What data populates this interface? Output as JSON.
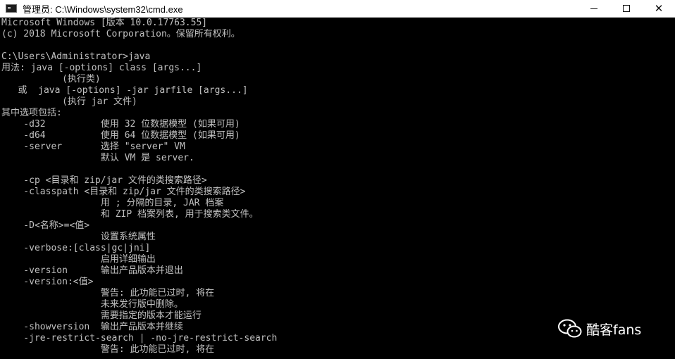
{
  "window": {
    "title": "管理员: C:\\Windows\\system32\\cmd.exe",
    "close_glyph": "✕"
  },
  "console": {
    "text_color": "#c0c0c0",
    "background": "#000000",
    "lines": [
      "Microsoft Windows [版本 10.0.17763.55]",
      "(c) 2018 Microsoft Corporation。保留所有权利。",
      "",
      "C:\\Users\\Administrator>java",
      "用法: java [-options] class [args...]",
      "           (执行类)",
      "   或  java [-options] -jar jarfile [args...]",
      "           (执行 jar 文件)",
      "其中选项包括:",
      "    -d32          使用 32 位数据模型 (如果可用)",
      "    -d64          使用 64 位数据模型 (如果可用)",
      "    -server       选择 \"server\" VM",
      "                  默认 VM 是 server.",
      "",
      "    -cp <目录和 zip/jar 文件的类搜索路径>",
      "    -classpath <目录和 zip/jar 文件的类搜索路径>",
      "                  用 ; 分隔的目录, JAR 档案",
      "                  和 ZIP 档案列表, 用于搜索类文件。",
      "    -D<名称>=<值>",
      "                  设置系统属性",
      "    -verbose:[class|gc|jni]",
      "                  启用详细输出",
      "    -version      输出产品版本并退出",
      "    -version:<值>",
      "                  警告: 此功能已过时, 将在",
      "                  未来发行版中删除。",
      "                  需要指定的版本才能运行",
      "    -showversion  输出产品版本并继续",
      "    -jre-restrict-search | -no-jre-restrict-search",
      "                  警告: 此功能已过时, 将在"
    ]
  },
  "watermark": {
    "text": "酷客fans",
    "icon": "wechat-icon"
  }
}
